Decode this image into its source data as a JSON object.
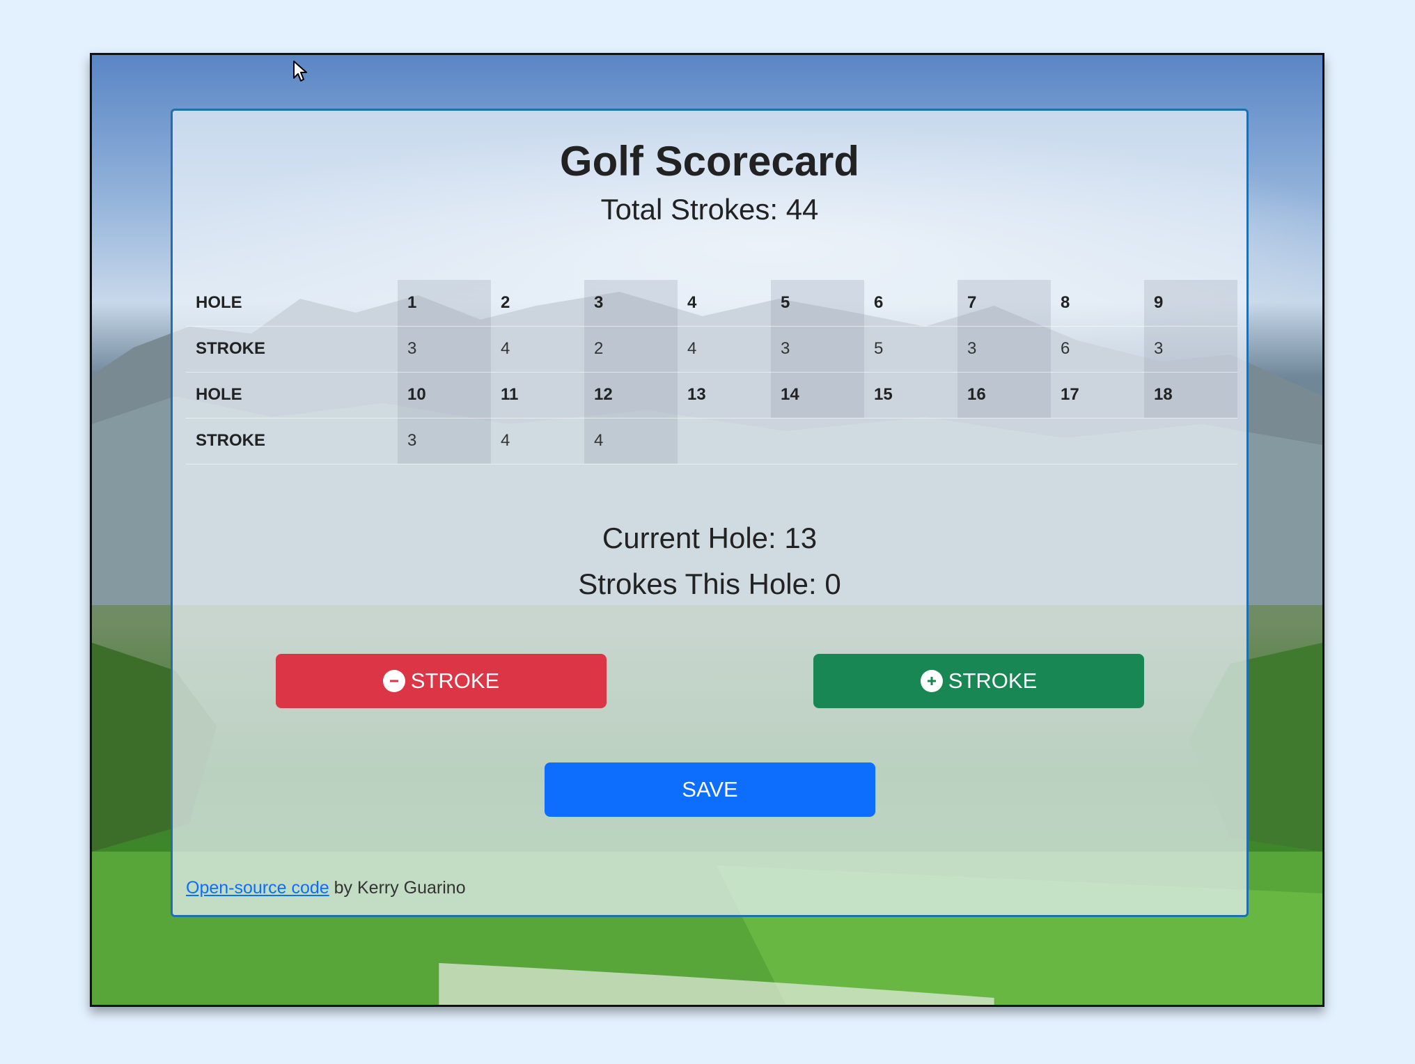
{
  "scorecard": {
    "title": "Golf Scorecard",
    "total_label": "Total Strokes: 44",
    "rows": [
      {
        "label": "HOLE",
        "type": "hole",
        "cells": [
          "1",
          "2",
          "3",
          "4",
          "5",
          "6",
          "7",
          "8",
          "9"
        ]
      },
      {
        "label": "STROKE",
        "type": "stroke",
        "cells": [
          "3",
          "4",
          "2",
          "4",
          "3",
          "5",
          "3",
          "6",
          "3"
        ]
      },
      {
        "label": "HOLE",
        "type": "hole",
        "cells": [
          "10",
          "11",
          "12",
          "13",
          "14",
          "15",
          "16",
          "17",
          "18"
        ]
      },
      {
        "label": "STROKE",
        "type": "stroke",
        "cells": [
          "3",
          "4",
          "4",
          "",
          "",
          "",
          "",
          "",
          ""
        ]
      }
    ],
    "current_hole_label": "Current Hole: 13",
    "strokes_this_hole_label": "Strokes This Hole: 0"
  },
  "buttons": {
    "minus_stroke": "STROKE",
    "plus_stroke": "STROKE",
    "save": "SAVE"
  },
  "footer": {
    "link_text": "Open-source code",
    "author_text": "by Kerry Guarino"
  },
  "colors": {
    "minus": "#dc3545",
    "plus": "#198754",
    "save": "#0d6efd"
  },
  "icons": {
    "minus": "minus-circle-icon",
    "plus": "plus-circle-icon",
    "cursor": "mouse-pointer-icon"
  }
}
